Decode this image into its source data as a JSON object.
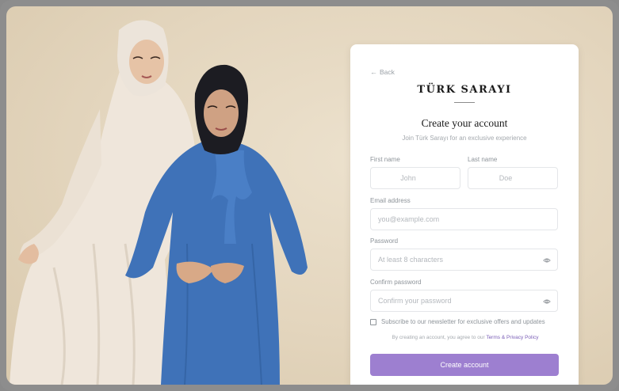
{
  "back_label": "Back",
  "brand": "TÜRK SARAYI",
  "title": "Create your account",
  "subtitle": "Join Türk Sarayı for an exclusive experience",
  "fields": {
    "first_name": {
      "label": "First name",
      "placeholder": "John"
    },
    "last_name": {
      "label": "Last name",
      "placeholder": "Doe"
    },
    "email": {
      "label": "Email address",
      "placeholder": "you@example.com"
    },
    "password": {
      "label": "Password",
      "placeholder": "At least 8 characters"
    },
    "confirm_password": {
      "label": "Confirm password",
      "placeholder": "Confirm your password"
    }
  },
  "newsletter_label": "Subscribe to our newsletter for exclusive offers and updates",
  "terms": {
    "prefix": "By creating an account, you agree to our",
    "terms_link": "Terms",
    "amp": "&",
    "privacy_link": "Privacy Policy"
  },
  "submit_label": "Create account",
  "colors": {
    "accent": "#9d7fd0",
    "background": "#e3d5bd",
    "dress_blue": "#3f72b8",
    "dress_cream": "#efe6db"
  },
  "icons": {
    "back": "arrow-left-icon",
    "password_toggle": "eye-icon"
  }
}
